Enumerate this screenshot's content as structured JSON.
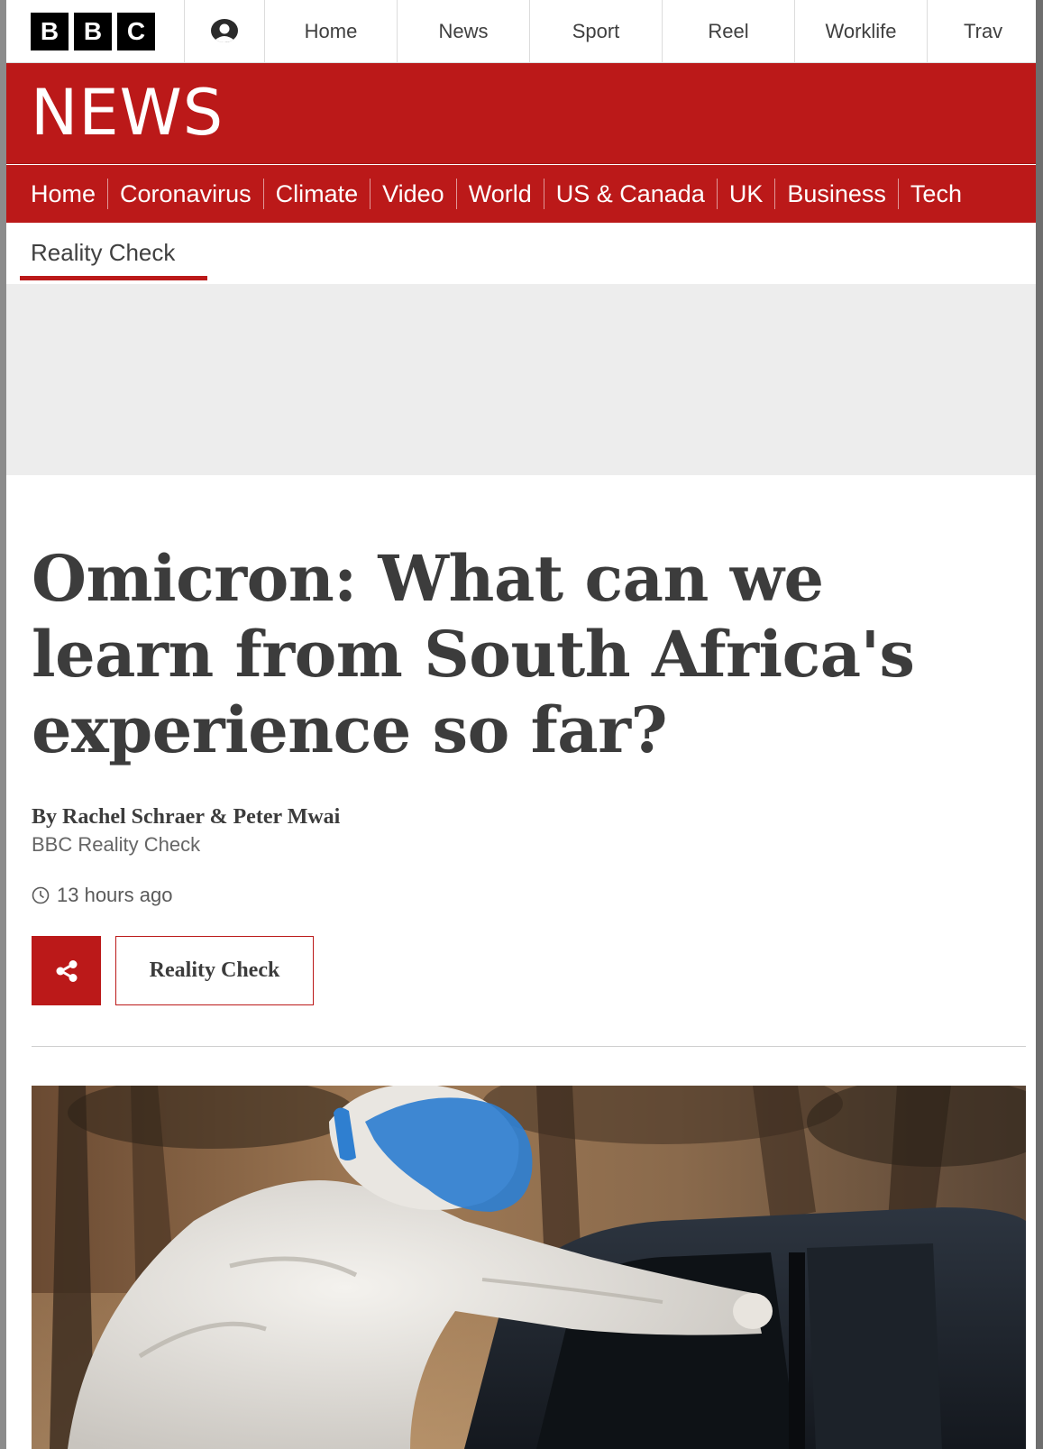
{
  "global_nav": {
    "logo_letters": [
      "B",
      "B",
      "C"
    ],
    "items": [
      "Home",
      "News",
      "Sport",
      "Reel",
      "Worklife",
      "Trav"
    ],
    "account_icon": "user-account-icon"
  },
  "news_banner": {
    "wordmark": "NEWS",
    "nav_items": [
      "Home",
      "Coronavirus",
      "Climate",
      "Video",
      "World",
      "US & Canada",
      "UK",
      "Business",
      "Tech"
    ]
  },
  "secondary_nav": {
    "current": "Reality Check"
  },
  "article": {
    "headline": "Omicron: What can we learn from South Africa's experience so far?",
    "byline": "By Rachel Schraer & Peter Mwai",
    "byline_role": "BBC Reality Check",
    "timestamp": "13 hours ago",
    "timestamp_icon": "clock-icon",
    "share_icon": "share-icon",
    "tag": "Reality Check"
  },
  "colors": {
    "brand_red": "#bb1919",
    "text_dark": "#3c3c3c",
    "ad_background": "#ededed"
  }
}
